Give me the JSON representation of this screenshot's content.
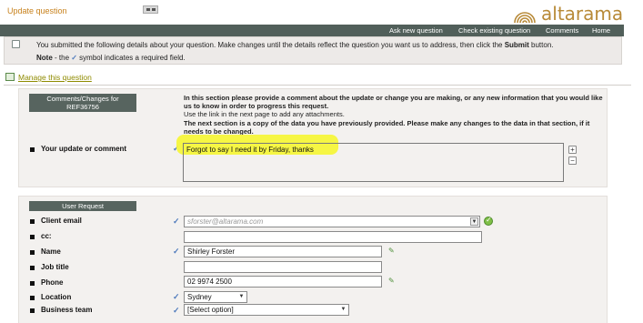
{
  "header": {
    "page_title": "Update question",
    "logo_text": "altarama"
  },
  "nav": {
    "items": [
      "Ask new question",
      "Check existing question",
      "Comments",
      "Home"
    ]
  },
  "message": {
    "line1_pre": "You submitted the following details about your question. Make changes until the details reflect the question you want us to address, then click the ",
    "line1_bold": "Submit",
    "line1_post": " button.",
    "line2_label": "Note",
    "line2_pre": " - the ",
    "line2_post": " symbol indicates a required field."
  },
  "manage_link": "Manage this question",
  "section1": {
    "header_line1": "Comments/Changes for",
    "header_line2": "REF36756",
    "info_bold1": "In this section please provide a comment about the update or change you are making, or any new information that you would like us to know in order to progress this request.",
    "info_plain": "Use the link in the next page to add any attachments.",
    "info_bold2": "The next section is a copy of the data you have previously provided. Please make any changes to the data in that section, if it needs to be changed.",
    "field_label": "Your update or comment",
    "field_value": "Forgot to say I need it by Friday, thanks"
  },
  "section2": {
    "header": "User Request",
    "fields": [
      {
        "label": "Client email",
        "value": "sforster@altarama.com",
        "required": true
      },
      {
        "label": "cc:",
        "value": "",
        "required": false
      },
      {
        "label": "Name",
        "value": "Shirley Forster",
        "required": true
      },
      {
        "label": "Job title",
        "value": "",
        "required": false
      },
      {
        "label": "Phone",
        "value": "02 9974 2500",
        "required": true
      },
      {
        "label": "Location",
        "value": "Sydney",
        "required": true
      },
      {
        "label": "Business team",
        "value": "[Select option]",
        "required": true
      }
    ]
  },
  "symbols": {
    "tick": "✓",
    "dropdown": "▼",
    "plus": "+",
    "minus": "−",
    "pencil": "✎"
  },
  "colors": {
    "nav_bg": "#515f5a",
    "brand": "#b88a38",
    "title": "#c7811c",
    "highlight": "#f6f53a",
    "tick": "#4f7bbd"
  }
}
